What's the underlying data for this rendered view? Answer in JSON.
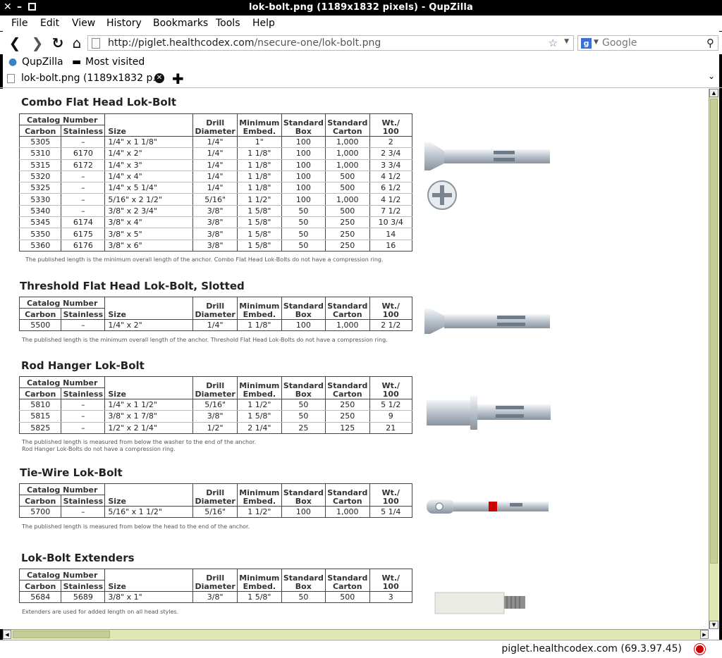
{
  "window": {
    "title": "lok-bolt.png (1189x1832 pixels) - QupZilla"
  },
  "menu": [
    "File",
    "Edit",
    "View",
    "History",
    "Bookmarks",
    "Tools",
    "Help"
  ],
  "nav": {
    "url_host": "http://piglet.healthcodex.com",
    "url_path": "/nsecure-one/lok-bolt.png",
    "search_placeholder": "Google"
  },
  "bookmarks": [
    "QupZilla",
    "Most visited"
  ],
  "tab": {
    "label": "lok-bolt.png (1189x1832 p..."
  },
  "status": {
    "text": "piglet.healthcodex.com (69.3.97.45)"
  },
  "headers": {
    "catalog": "Catalog Number",
    "carbon": "Carbon",
    "stainless": "Stainless",
    "size": "Size",
    "drill_1": "Drill",
    "drill_2": "Diameter",
    "min_1": "Minimum",
    "min_2": "Embed.",
    "box_1": "Standard",
    "box_2": "Box",
    "carton_1": "Standard",
    "carton_2": "Carton",
    "wt_1": "Wt./",
    "wt_2": "100"
  },
  "sections": [
    {
      "title": "Combo Flat Head Lok-Bolt",
      "rows": [
        [
          "5305",
          "–",
          "1/4\" x 1 1/8\"",
          "1/4\"",
          "1\"",
          "100",
          "1,000",
          "2"
        ],
        [
          "5310",
          "6170",
          "1/4\" x 2\"",
          "1/4\"",
          "1 1/8\"",
          "100",
          "1,000",
          "2 3/4"
        ],
        [
          "5315",
          "6172",
          "1/4\" x 3\"",
          "1/4\"",
          "1 1/8\"",
          "100",
          "1,000",
          "3 3/4"
        ],
        [
          "5320",
          "–",
          "1/4\" x 4\"",
          "1/4\"",
          "1 1/8\"",
          "100",
          "500",
          "4 1/2"
        ],
        [
          "5325",
          "–",
          "1/4\" x 5 1/4\"",
          "1/4\"",
          "1 1/8\"",
          "100",
          "500",
          "6 1/2"
        ],
        [
          "5330",
          "–",
          "5/16\" x 2 1/2\"",
          "5/16\"",
          "1 1/2\"",
          "100",
          "1,000",
          "4 1/2"
        ],
        [
          "5340",
          "–",
          "3/8\" x 2 3/4\"",
          "3/8\"",
          "1 5/8\"",
          "50",
          "500",
          "7 1/2"
        ],
        [
          "5345",
          "6174",
          "3/8\" x 4\"",
          "3/8\"",
          "1 5/8\"",
          "50",
          "250",
          "10 3/4"
        ],
        [
          "5350",
          "6175",
          "3/8\" x 5\"",
          "3/8\"",
          "1 5/8\"",
          "50",
          "250",
          "14"
        ],
        [
          "5360",
          "6176",
          "3/8\" x 6\"",
          "3/8\"",
          "1 5/8\"",
          "50",
          "250",
          "16"
        ]
      ],
      "notes": [
        "The published length is the minimum overall length of the anchor. Combo Flat Head Lok-Bolts do not have a compression ring."
      ]
    },
    {
      "title": "Threshold Flat Head Lok-Bolt, Slotted",
      "rows": [
        [
          "5500",
          "–",
          "1/4\" x 2\"",
          "1/4\"",
          "1 1/8\"",
          "100",
          "1,000",
          "2 1/2"
        ]
      ],
      "notes": [
        "The published length is the minimum overall length of the anchor. Threshold Flat Head Lok-Bolts do not have a compression ring."
      ]
    },
    {
      "title": "Rod Hanger Lok-Bolt",
      "rows": [
        [
          "5810",
          "–",
          "1/4\" x 1 1/2\"",
          "5/16\"",
          "1 1/2\"",
          "50",
          "250",
          "5 1/2"
        ],
        [
          "5815",
          "–",
          "3/8\" x 1 7/8\"",
          "3/8\"",
          "1 5/8\"",
          "50",
          "250",
          "9"
        ],
        [
          "5825",
          "–",
          "1/2\" x 2 1/4\"",
          "1/2\"",
          "2 1/4\"",
          "25",
          "125",
          "21"
        ]
      ],
      "notes": [
        "The published length is measured from below the washer to the end of the anchor.",
        "Rod Hanger Lok-Bolts do not have a compression ring."
      ]
    },
    {
      "title": "Tie-Wire Lok-Bolt",
      "rows": [
        [
          "5700",
          "–",
          "5/16\" x 1 1/2\"",
          "5/16\"",
          "1 1/2\"",
          "100",
          "1,000",
          "5 1/4"
        ]
      ],
      "notes": [
        "The published length is measured from below the head to the end of the anchor."
      ]
    },
    {
      "title": "Lok-Bolt Extenders",
      "rows": [
        [
          "5684",
          "5689",
          "3/8\" x 1\"",
          "3/8\"",
          "1 5/8\"",
          "50",
          "500",
          "3"
        ]
      ],
      "notes": [
        "Extenders are used for added length on all head styles."
      ]
    }
  ],
  "colors": {
    "scrollbar": "#dfe8b2",
    "accent_red": "#cc0000"
  }
}
